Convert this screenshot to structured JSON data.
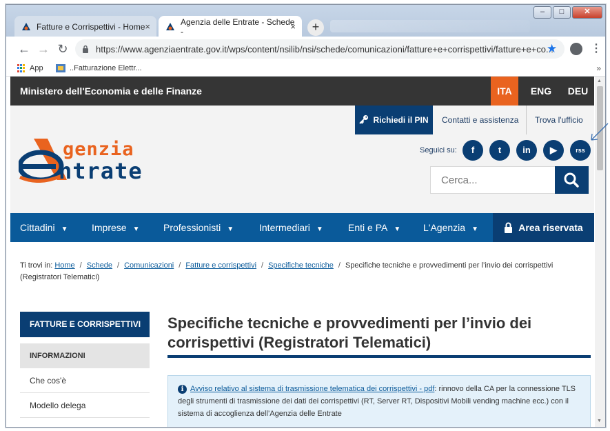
{
  "browser": {
    "tabs": [
      {
        "label": "Fatture e Corrispettivi - Home",
        "close": "×"
      },
      {
        "label": "Agenzia delle Entrate - Schede -",
        "close": "×"
      }
    ],
    "new_tab": "+",
    "window_controls": {
      "minimize": "–",
      "maximize": "□",
      "close": "✕"
    },
    "nav": {
      "back": "←",
      "forward": "→",
      "reload": "↻"
    },
    "url": "https://www.agenziaentrate.gov.it/wps/content/nsilib/nsi/schede/comunicazioni/fatture+e+corrispettivi/fatture+e+co...",
    "star": "★",
    "menu": "⋮",
    "bookmarks": [
      {
        "label": "App"
      },
      {
        "label": "..Fatturazione Elettr..."
      }
    ],
    "bookmarks_more": "»"
  },
  "site": {
    "ministry_title": "Ministero dell'Economia e delle Finanze",
    "languages": [
      {
        "label": "ITA",
        "active": true
      },
      {
        "label": "ENG",
        "active": false
      },
      {
        "label": "DEU",
        "active": false
      }
    ],
    "pin_button": "Richiedi il PIN",
    "top_links": [
      "Contatti e assistenza",
      "Trova l'ufficio"
    ],
    "social_label": "Seguici su:",
    "social_icons": [
      "f",
      "t",
      "in",
      "▶",
      "rss"
    ],
    "search_placeholder": "Cerca...",
    "logo": {
      "line1": "genzia",
      "line2": "ntrate"
    },
    "nav_items": [
      "Cittadini",
      "Imprese",
      "Professionisti",
      "Intermediari",
      "Enti e PA",
      "L'Agenzia"
    ],
    "nav_caret": "▼",
    "area_riservata": "Area riservata",
    "breadcrumb": {
      "prefix": "Ti trovi in:",
      "links": [
        "Home",
        "Schede",
        "Comunicazioni",
        "Fatture e corrispettivi",
        "Specifiche tecniche"
      ],
      "separator": "/",
      "current": "Specifiche tecniche e provvedimenti per l’invio dei corrispettivi (Registratori Telematici)"
    },
    "sidebar": {
      "heading": "FATTURE E CORRISPETTIVI",
      "subheading": "INFORMAZIONI",
      "items": [
        "Che cos'è",
        "Modello delega"
      ]
    },
    "page_title": "Specifiche tecniche e provvedimenti per l’invio dei corrispettivi (Registratori Telematici)",
    "notice": {
      "link": "Avviso relativo al sistema di trasmissione telematica dei corrispettivi - pdf",
      "text": ": rinnovo della CA per la connessione TLS degli strumenti di trasmissione dei dati dei corrispettivi (RT, Server RT, Dispositivi Mobili vending machine ecc.) con il sistema di accoglienza dell’Agenzia delle Entrate"
    }
  },
  "colors": {
    "accent_orange": "#e9631f",
    "brand_navy": "#0a3e73",
    "nav_blue": "#0a5a9a",
    "ministry_bar": "#353535"
  }
}
